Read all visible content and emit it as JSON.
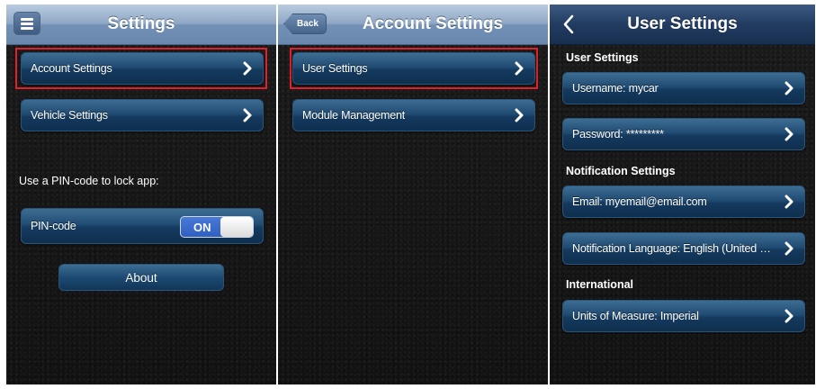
{
  "screen1": {
    "title": "Settings",
    "menu_icon": "hamburger-menu-icon",
    "items": [
      {
        "label": "Account Settings",
        "icon": "chevron-right-icon",
        "highlighted": true
      },
      {
        "label": "Vehicle Settings",
        "icon": "chevron-right-icon",
        "highlighted": false
      }
    ],
    "pin_hint": "Use a PIN-code to lock app:",
    "pin_row": {
      "label": "PIN-code",
      "toggle_state": "ON"
    },
    "about_label": "About"
  },
  "screen2": {
    "title": "Account Settings",
    "back_label": "Back",
    "items": [
      {
        "label": "User Settings",
        "icon": "chevron-right-icon",
        "highlighted": true
      },
      {
        "label": "Module Management",
        "icon": "chevron-right-icon",
        "highlighted": false
      }
    ]
  },
  "screen3": {
    "title": "User Settings",
    "back_icon": "chevron-left-icon",
    "sections": [
      {
        "header": "User Settings",
        "items": [
          {
            "label": "Username: mycar"
          },
          {
            "label": "Password: *********"
          }
        ]
      },
      {
        "header": "Notification Settings",
        "items": [
          {
            "label": "Email: myemail@email.com"
          },
          {
            "label": "Notification Language: English (United States)"
          }
        ]
      },
      {
        "header": "International",
        "items": [
          {
            "label": "Units of Measure: Imperial"
          }
        ]
      }
    ]
  },
  "colors": {
    "highlight": "#e0202a",
    "cell_blue": "#214c73",
    "toggle_on": "#3b6ad0",
    "background": "#151515"
  }
}
